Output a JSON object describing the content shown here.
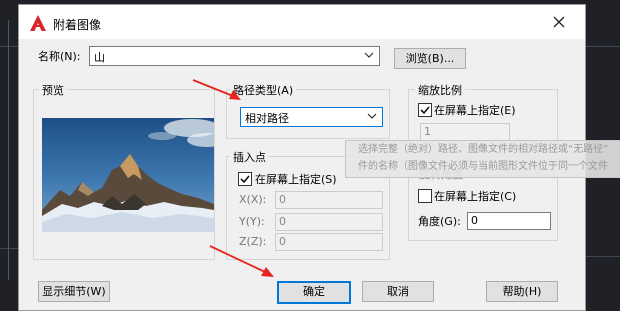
{
  "dialog": {
    "title": "附着图像",
    "name_label": "名称(N):",
    "name_value": "山",
    "browse_button": "浏览(B)...",
    "preview_title": "预览",
    "path_type": {
      "title": "路径类型(A)",
      "selected": "相对路径"
    },
    "insertion_point": {
      "title": "插入点",
      "specify_on_screen": "在屏幕上指定(S)",
      "x_label": "X(X):",
      "x_value": "0",
      "y_label": "Y(Y):",
      "y_value": "0",
      "z_label": "Z(Z):",
      "z_value": "0"
    },
    "scale": {
      "title": "缩放比例",
      "specify_on_screen": "在屏幕上指定(E)",
      "value": "1"
    },
    "rotation": {
      "title": "旋转角度",
      "specify_on_screen": "在屏幕上指定(C)",
      "angle_label": "角度(G):",
      "angle_value": "0"
    },
    "tooltip": {
      "line1": "选择完整（绝对）路径、图像文件的相对路径或“无路径”",
      "line2": "件的名称（图像文件必须与当前图形文件位于同一个文件"
    },
    "buttons": {
      "details": "显示细节(W)",
      "ok": "确定",
      "cancel": "取消",
      "help": "帮助(H)"
    }
  },
  "colors": {
    "app_icon": "#d8252b",
    "annotation_arrow": "#e5251f",
    "default_button_border": "#0078d7"
  }
}
